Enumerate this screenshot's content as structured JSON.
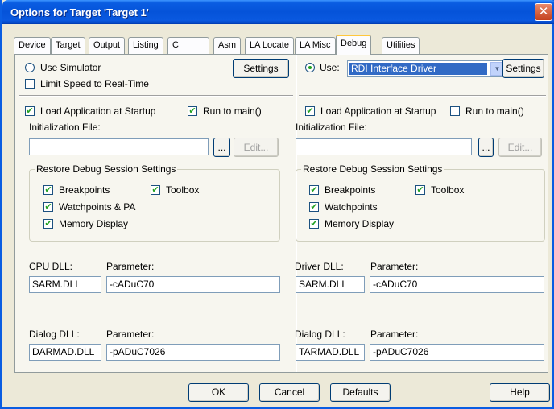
{
  "window": {
    "title": "Options for Target 'Target 1'",
    "close_glyph": "✕"
  },
  "tabs": [
    {
      "label": "Device"
    },
    {
      "label": "Target"
    },
    {
      "label": "Output"
    },
    {
      "label": "Listing"
    },
    {
      "label": "C"
    },
    {
      "label": "Asm"
    },
    {
      "label": "LA Locate"
    },
    {
      "label": "LA Misc"
    },
    {
      "label": "Debug",
      "active": true
    },
    {
      "label": "Utilities"
    }
  ],
  "left": {
    "use_simulator": "Use Simulator",
    "settings": "Settings",
    "limit_speed": "Limit Speed to Real-Time",
    "load_app": "Load Application at Startup",
    "run_to_main": "Run to main()",
    "init_file_label": "Initialization File:",
    "init_file_value": "",
    "browse": "...",
    "edit": "Edit...",
    "restore_title": "Restore Debug Session Settings",
    "breakpoints": "Breakpoints",
    "toolbox": "Toolbox",
    "watchpoints": "Watchpoints & PA",
    "memory_display": "Memory Display",
    "cpu_dll_label": "CPU DLL:",
    "cpu_dll_value": "SARM.DLL",
    "cpu_param_label": "Parameter:",
    "cpu_param_value": "-cADuC70",
    "dialog_dll_label": "Dialog DLL:",
    "dialog_dll_value": "DARMAD.DLL",
    "dialog_param_label": "Parameter:",
    "dialog_param_value": "-pADuC7026"
  },
  "right": {
    "use_label": "Use:",
    "driver_selected": "RDI Interface Driver",
    "settings": "Settings",
    "load_app": "Load Application at Startup",
    "run_to_main": "Run to main()",
    "init_file_label": "Initialization File:",
    "init_file_value": "",
    "browse": "...",
    "edit": "Edit...",
    "restore_title": "Restore Debug Session Settings",
    "breakpoints": "Breakpoints",
    "toolbox": "Toolbox",
    "watchpoints": "Watchpoints",
    "memory_display": "Memory Display",
    "driver_dll_label": "Driver DLL:",
    "driver_dll_value": "SARM.DLL",
    "driver_param_label": "Parameter:",
    "driver_param_value": "-cADuC70",
    "dialog_dll_label": "Dialog DLL:",
    "dialog_dll_value": "TARMAD.DLL",
    "dialog_param_label": "Parameter:",
    "dialog_param_value": "-pADuC7026"
  },
  "footer": {
    "ok": "OK",
    "cancel": "Cancel",
    "defaults": "Defaults",
    "help": "Help"
  },
  "glyphs": {
    "check": "✔",
    "dropdown": "▼"
  }
}
